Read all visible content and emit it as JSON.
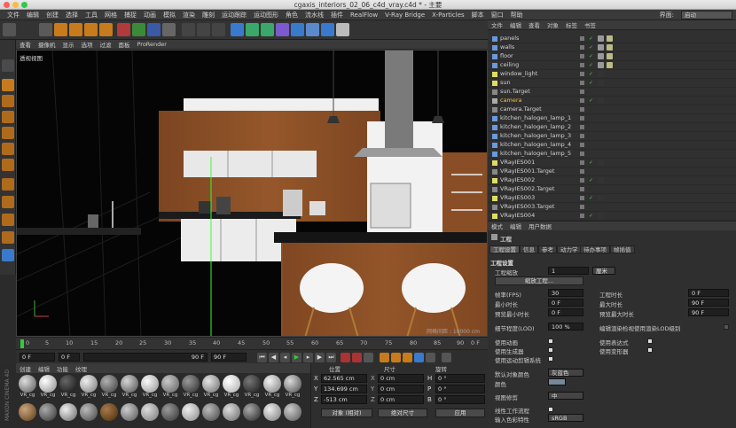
{
  "window": {
    "title": "cgaxis_interiors_02_06_c4d_vray.c4d * - 主要"
  },
  "menubar": {
    "items": [
      "文件",
      "编辑",
      "创建",
      "选择",
      "工具",
      "网格",
      "捕捉",
      "动画",
      "模拟",
      "渲染",
      "雕刻",
      "运动跟踪",
      "运动图形",
      "角色",
      "流水线",
      "插件",
      "RealFlow",
      "V-Ray Bridge",
      "X-Particles",
      "脚本",
      "窗口",
      "帮助"
    ],
    "layout_label": "界面:",
    "layout_value": "启动"
  },
  "viewport": {
    "menu": [
      "查看",
      "摄像机",
      "显示",
      "选项",
      "过滤",
      "面板",
      "ProRender"
    ],
    "label": "透视视图",
    "grid_label": "网格间距 : 10000 cm"
  },
  "timeline": {
    "ticks": [
      "0",
      "5",
      "10",
      "15",
      "20",
      "25",
      "30",
      "35",
      "40",
      "45",
      "50",
      "55",
      "60",
      "65",
      "70",
      "75",
      "80",
      "85",
      "90"
    ],
    "end": "0 F"
  },
  "playback": {
    "start": "0 F",
    "current": "0 F",
    "max": "90 F",
    "end": "90 F"
  },
  "materials": {
    "menu": [
      "创建",
      "编辑",
      "功能",
      "纹理"
    ],
    "items": [
      "VR_cg",
      "VR_cg",
      "VR_cg",
      "VR_cg",
      "VR_cg",
      "VR_cg",
      "VR_cg",
      "VR_cg",
      "VR_cg",
      "VR_cg",
      "VR_cg",
      "VR_cg",
      "VR_cg",
      "VR_cg"
    ],
    "logo": "MAXON CINEMA 4D"
  },
  "coords": {
    "headers": [
      "位置",
      "尺寸",
      "旋转"
    ],
    "rows": [
      {
        "axis": "X",
        "pos": "62.565 cm",
        "size": "0 cm",
        "rot_axis": "H",
        "rot": "0 °"
      },
      {
        "axis": "Y",
        "pos": "134.699 cm",
        "size": "0 cm",
        "rot_axis": "P",
        "rot": "0 °"
      },
      {
        "axis": "Z",
        "pos": "-513 cm",
        "size": "0 cm",
        "rot_axis": "B",
        "rot": "0 °"
      }
    ],
    "mode": "对象 (相对)",
    "size_mode": "绝对尺寸",
    "apply": "应用"
  },
  "object_manager": {
    "menu": [
      "文件",
      "编辑",
      "查看",
      "对象",
      "标签",
      "书签"
    ],
    "objects": [
      "panels",
      "walls",
      "floor",
      "ceiling",
      "window_light",
      "sun",
      "sun.Target",
      "camera",
      "camera.Target",
      "kitchen_halogen_lamp_1",
      "kitchen_halogen_lamp_2",
      "kitchen_halogen_lamp_3",
      "kitchen_halogen_lamp_4",
      "kitchen_halogen_lamp_5",
      "VRayIES001",
      "VRayIES001.Target",
      "VRayIES002",
      "VRayIES002.Target",
      "VRayIES003",
      "VRayIES003.Target",
      "VRayIES004"
    ],
    "highlight": "camera"
  },
  "attributes": {
    "menu": [
      "模式",
      "编辑",
      "用户数据"
    ],
    "title": "工程",
    "tabs": [
      "工程设置",
      "信息",
      "参考",
      "动力学",
      "待办事项",
      "帧插值"
    ],
    "section": "工程设置",
    "scale_label": "工程缩放",
    "scale_value": "1",
    "scale_unit": "厘米",
    "scale_button": "缩放工程...",
    "fps_label": "帧率(FPS)",
    "fps_value": "30",
    "time_label": "工程时长",
    "time_value": "0 F",
    "min_label": "最小时长",
    "min_value": "0 F",
    "max_label": "最大时长",
    "max_value": "90 F",
    "pmin_label": "预览最小时长",
    "pmin_value": "0 F",
    "pmax_label": "预览最大时长",
    "pmax_value": "90 F",
    "lod_label": "细节程度(LOD)",
    "lod_value": "100 %",
    "lod_render_label": "编辑渲染检视使用渲染LOD级别",
    "use_anim": "使用动画",
    "use_expr": "使用表达式",
    "use_gen": "使用生成器",
    "use_deform": "使用变形器",
    "use_motion": "使用运动剪辑系统",
    "default_color_label": "默认对象颜色",
    "default_color_value": "灰蓝色",
    "color_label": "颜色",
    "view_clip_label": "视图修剪",
    "view_clip_value": "中",
    "linear_label": "线性工作流程",
    "input_color_label": "输入色彩特性",
    "input_color_value": "sRGB"
  }
}
